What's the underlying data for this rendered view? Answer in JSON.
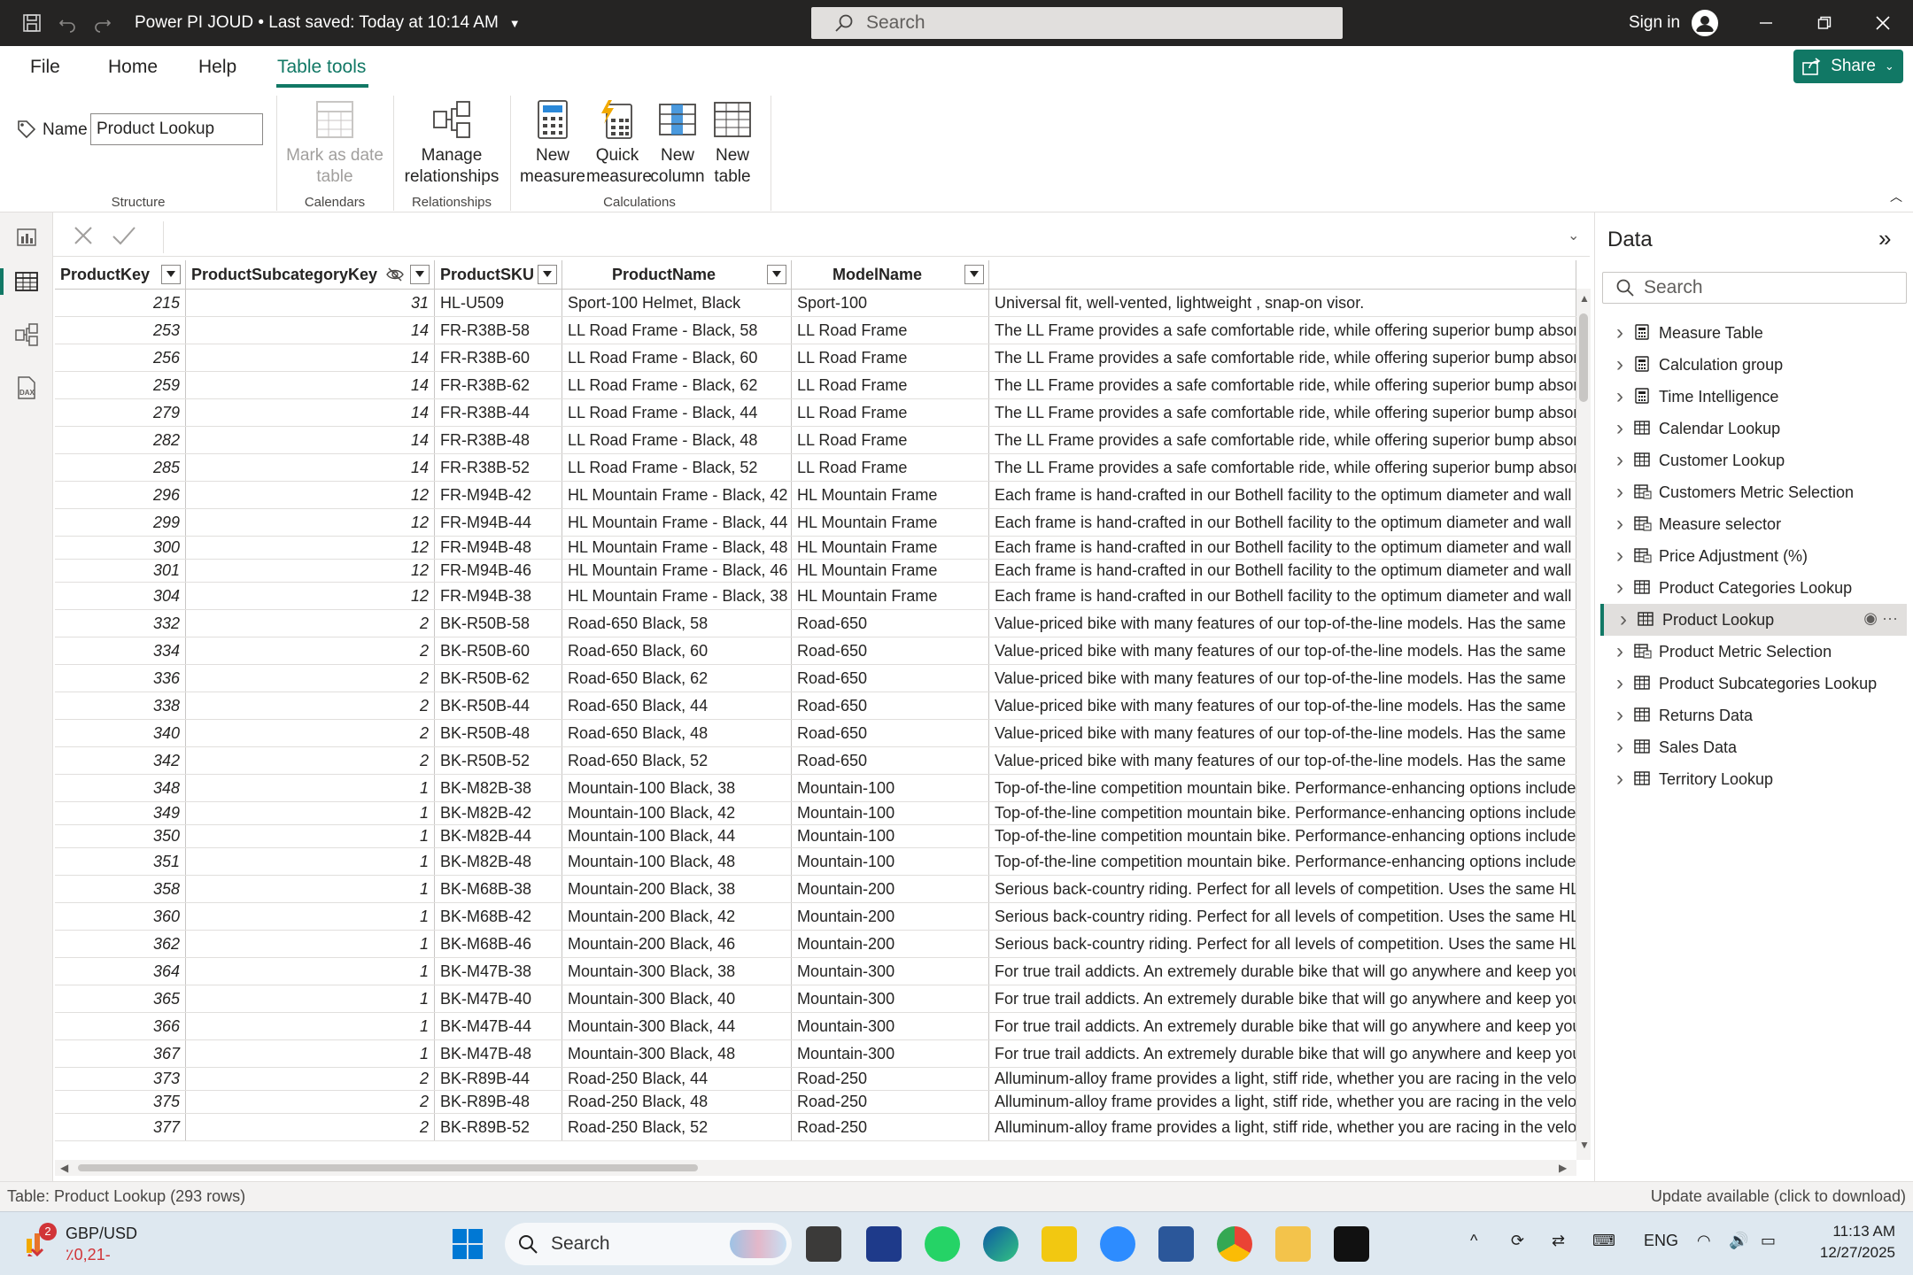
{
  "titlebar": {
    "title": "Power PI JOUD • Last saved: Today at 10:14 AM",
    "search_placeholder": "Search",
    "signin": "Sign in"
  },
  "menu": {
    "tabs": [
      "File",
      "Home",
      "Help",
      "Table tools"
    ],
    "active_tab": "Table tools",
    "share_label": "Share"
  },
  "ribbon": {
    "name_label": "Name",
    "name_value": "Product Lookup",
    "groups": {
      "structure": "Structure",
      "calendars": "Calendars",
      "relationships": "Relationships",
      "calculations": "Calculations"
    },
    "buttons": {
      "mark_date_line1": "Mark as date",
      "mark_date_line2": "table",
      "manage_rel_line1": "Manage",
      "manage_rel_line2": "relationships",
      "new_measure_line1": "New",
      "new_measure_line2": "measure",
      "quick_measure_line1": "Quick",
      "quick_measure_line2": "measure",
      "new_column_line1": "New",
      "new_column_line2": "column",
      "new_table_line1": "New",
      "new_table_line2": "table"
    }
  },
  "grid": {
    "columns": [
      "ProductKey",
      "ProductSubcategoryKey",
      "ProductSKU",
      "ProductName",
      "ModelName",
      ""
    ],
    "rows": [
      [
        "215",
        "31",
        "HL-U509",
        "Sport-100 Helmet, Black",
        "Sport-100",
        "Universal fit, well-vented, lightweight , snap-on visor."
      ],
      [
        "253",
        "14",
        "FR-R38B-58",
        "LL Road Frame - Black, 58",
        "LL Road Frame",
        "The LL Frame provides a safe comfortable ride, while offering superior bump absorption"
      ],
      [
        "256",
        "14",
        "FR-R38B-60",
        "LL Road Frame - Black, 60",
        "LL Road Frame",
        "The LL Frame provides a safe comfortable ride, while offering superior bump absorption"
      ],
      [
        "259",
        "14",
        "FR-R38B-62",
        "LL Road Frame - Black, 62",
        "LL Road Frame",
        "The LL Frame provides a safe comfortable ride, while offering superior bump absorption"
      ],
      [
        "279",
        "14",
        "FR-R38B-44",
        "LL Road Frame - Black, 44",
        "LL Road Frame",
        "The LL Frame provides a safe comfortable ride, while offering superior bump absorption"
      ],
      [
        "282",
        "14",
        "FR-R38B-48",
        "LL Road Frame - Black, 48",
        "LL Road Frame",
        "The LL Frame provides a safe comfortable ride, while offering superior bump absorption"
      ],
      [
        "285",
        "14",
        "FR-R38B-52",
        "LL Road Frame - Black, 52",
        "LL Road Frame",
        "The LL Frame provides a safe comfortable ride, while offering superior bump absorption"
      ],
      [
        "296",
        "12",
        "FR-M94B-42",
        "HL Mountain Frame - Black, 42",
        "HL Mountain Frame",
        "Each frame is hand-crafted in our Bothell facility to the optimum diameter and wall"
      ],
      [
        "299",
        "12",
        "FR-M94B-44",
        "HL Mountain Frame - Black, 44",
        "HL Mountain Frame",
        "Each frame is hand-crafted in our Bothell facility to the optimum diameter and wall"
      ],
      [
        "300",
        "12",
        "FR-M94B-48",
        "HL Mountain Frame - Black, 48",
        "HL Mountain Frame",
        "Each frame is hand-crafted in our Bothell facility to the optimum diameter and wall"
      ],
      [
        "301",
        "12",
        "FR-M94B-46",
        "HL Mountain Frame - Black, 46",
        "HL Mountain Frame",
        "Each frame is hand-crafted in our Bothell facility to the optimum diameter and wall"
      ],
      [
        "304",
        "12",
        "FR-M94B-38",
        "HL Mountain Frame - Black, 38",
        "HL Mountain Frame",
        "Each frame is hand-crafted in our Bothell facility to the optimum diameter and wall"
      ],
      [
        "332",
        "2",
        "BK-R50B-58",
        "Road-650 Black, 58",
        "Road-650",
        "Value-priced bike with many features of our top-of-the-line models. Has the same"
      ],
      [
        "334",
        "2",
        "BK-R50B-60",
        "Road-650 Black, 60",
        "Road-650",
        "Value-priced bike with many features of our top-of-the-line models. Has the same"
      ],
      [
        "336",
        "2",
        "BK-R50B-62",
        "Road-650 Black, 62",
        "Road-650",
        "Value-priced bike with many features of our top-of-the-line models. Has the same"
      ],
      [
        "338",
        "2",
        "BK-R50B-44",
        "Road-650 Black, 44",
        "Road-650",
        "Value-priced bike with many features of our top-of-the-line models. Has the same"
      ],
      [
        "340",
        "2",
        "BK-R50B-48",
        "Road-650 Black, 48",
        "Road-650",
        "Value-priced bike with many features of our top-of-the-line models. Has the same"
      ],
      [
        "342",
        "2",
        "BK-R50B-52",
        "Road-650 Black, 52",
        "Road-650",
        "Value-priced bike with many features of our top-of-the-line models. Has the same"
      ],
      [
        "348",
        "1",
        "BK-M82B-38",
        "Mountain-100 Black, 38",
        "Mountain-100",
        "Top-of-the-line competition mountain bike. Performance-enhancing options include"
      ],
      [
        "349",
        "1",
        "BK-M82B-42",
        "Mountain-100 Black, 42",
        "Mountain-100",
        "Top-of-the-line competition mountain bike. Performance-enhancing options include"
      ],
      [
        "350",
        "1",
        "BK-M82B-44",
        "Mountain-100 Black, 44",
        "Mountain-100",
        "Top-of-the-line competition mountain bike. Performance-enhancing options include"
      ],
      [
        "351",
        "1",
        "BK-M82B-48",
        "Mountain-100 Black, 48",
        "Mountain-100",
        "Top-of-the-line competition mountain bike. Performance-enhancing options include"
      ],
      [
        "358",
        "1",
        "BK-M68B-38",
        "Mountain-200 Black, 38",
        "Mountain-200",
        "Serious back-country riding. Perfect for all levels of competition. Uses the same HL"
      ],
      [
        "360",
        "1",
        "BK-M68B-42",
        "Mountain-200 Black, 42",
        "Mountain-200",
        "Serious back-country riding. Perfect for all levels of competition. Uses the same HL"
      ],
      [
        "362",
        "1",
        "BK-M68B-46",
        "Mountain-200 Black, 46",
        "Mountain-200",
        "Serious back-country riding. Perfect for all levels of competition. Uses the same HL"
      ],
      [
        "364",
        "1",
        "BK-M47B-38",
        "Mountain-300 Black, 38",
        "Mountain-300",
        "For true trail addicts.  An extremely durable bike that will go anywhere and keep you"
      ],
      [
        "365",
        "1",
        "BK-M47B-40",
        "Mountain-300 Black, 40",
        "Mountain-300",
        "For true trail addicts.  An extremely durable bike that will go anywhere and keep you"
      ],
      [
        "366",
        "1",
        "BK-M47B-44",
        "Mountain-300 Black, 44",
        "Mountain-300",
        "For true trail addicts.  An extremely durable bike that will go anywhere and keep you"
      ],
      [
        "367",
        "1",
        "BK-M47B-48",
        "Mountain-300 Black, 48",
        "Mountain-300",
        "For true trail addicts.  An extremely durable bike that will go anywhere and keep you"
      ],
      [
        "373",
        "2",
        "BK-R89B-44",
        "Road-250 Black, 44",
        "Road-250",
        "Alluminum-alloy frame provides a light, stiff ride, whether you are racing in the velodrome"
      ],
      [
        "375",
        "2",
        "BK-R89B-48",
        "Road-250 Black, 48",
        "Road-250",
        "Alluminum-alloy frame provides a light, stiff ride, whether you are racing in the velodrome"
      ],
      [
        "377",
        "2",
        "BK-R89B-52",
        "Road-250 Black, 52",
        "Road-250",
        "Alluminum-alloy frame provides a light, stiff ride, whether you are racing in the velodrome"
      ]
    ]
  },
  "data_pane": {
    "title": "Data",
    "search_placeholder": "Search",
    "items": [
      {
        "label": "Measure Table",
        "icon": "calculator-table-icon"
      },
      {
        "label": "Calculation group",
        "icon": "calculator-table-icon"
      },
      {
        "label": "Time Intelligence",
        "icon": "calculator-table-icon"
      },
      {
        "label": "Calendar Lookup",
        "icon": "table-icon"
      },
      {
        "label": "Customer Lookup",
        "icon": "table-icon"
      },
      {
        "label": "Customers Metric Selection",
        "icon": "calc-table-icon"
      },
      {
        "label": "Measure selector",
        "icon": "calc-table-icon"
      },
      {
        "label": "Price Adjustment (%)",
        "icon": "calc-table-icon"
      },
      {
        "label": "Product Categories Lookup",
        "icon": "table-icon"
      },
      {
        "label": "Product Lookup",
        "icon": "table-icon"
      },
      {
        "label": "Product Metric Selection",
        "icon": "calc-table-icon"
      },
      {
        "label": "Product Subcategories Lookup",
        "icon": "table-icon"
      },
      {
        "label": "Returns Data",
        "icon": "table-icon"
      },
      {
        "label": "Sales Data",
        "icon": "table-icon"
      },
      {
        "label": "Territory Lookup",
        "icon": "table-icon"
      }
    ],
    "selected": "Product Lookup"
  },
  "status": {
    "left": "Table: Product Lookup (293 rows)",
    "right": "Update available (click to download)"
  },
  "taskbar": {
    "weather_badge": "2",
    "weather_title": "GBP/USD",
    "weather_value": "٪0,21-",
    "search_placeholder": "Search",
    "language": "ENG",
    "time": "11:13 AM",
    "date": "12/27/2025"
  },
  "colors": {
    "accent": "#117865",
    "titlebar": "#252423"
  }
}
